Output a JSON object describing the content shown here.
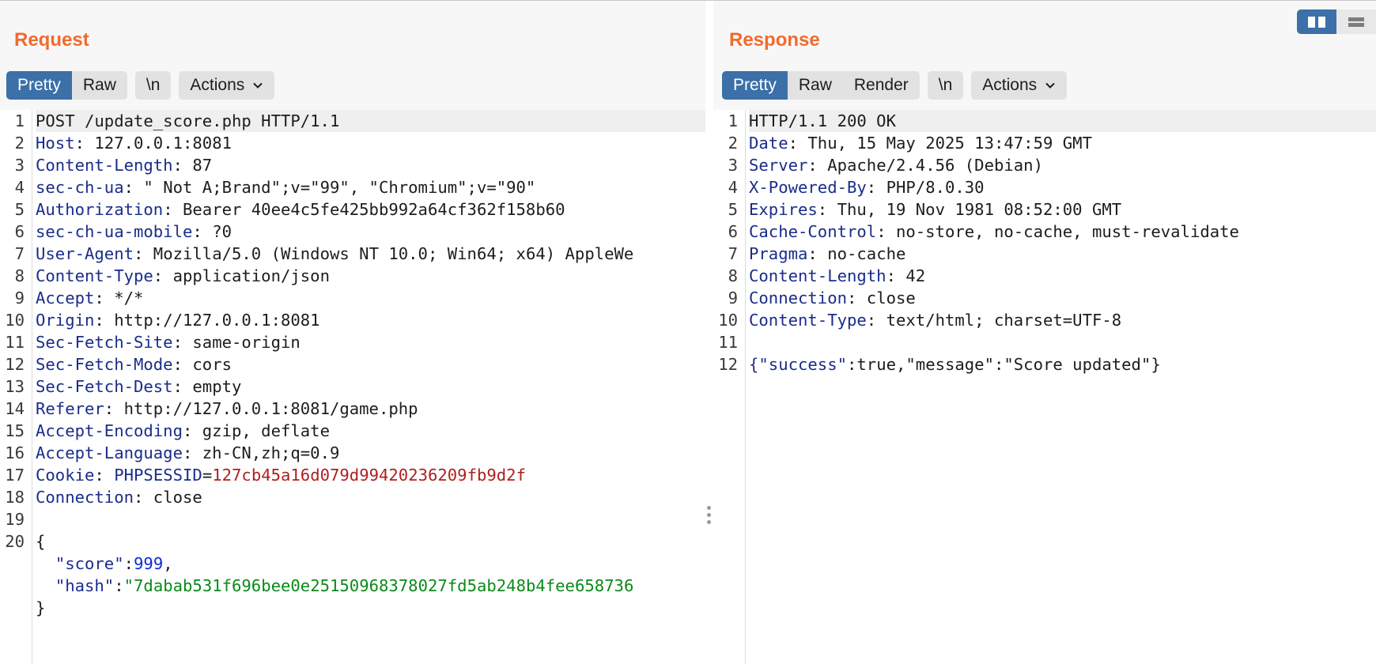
{
  "request": {
    "title": "Request",
    "tabs": [
      {
        "label": "Pretty",
        "active": true
      },
      {
        "label": "Raw",
        "active": false
      }
    ],
    "newline_label": "\\n",
    "actions_label": "Actions",
    "lines": [
      "POST /update_score.php HTTP/1.1",
      "Host: 127.0.0.1:8081",
      "Content-Length: 87",
      "sec-ch-ua: \" Not A;Brand\";v=\"99\", \"Chromium\";v=\"90\"",
      "Authorization: Bearer 40ee4c5fe425bb992a64cf362f158b60",
      "sec-ch-ua-mobile: ?0",
      "User-Agent: Mozilla/5.0 (Windows NT 10.0; Win64; x64) AppleWe",
      "Content-Type: application/json",
      "Accept: */*",
      "Origin: http://127.0.0.1:8081",
      "Sec-Fetch-Site: same-origin",
      "Sec-Fetch-Mode: cors",
      "Sec-Fetch-Dest: empty",
      "Referer: http://127.0.0.1:8081/game.php",
      "Accept-Encoding: gzip, deflate",
      "Accept-Language: zh-CN,zh;q=0.9",
      "Cookie: PHPSESSID=127cb45a16d079d99420236209fb9d2f",
      "Connection: close",
      "",
      "{"
    ],
    "body_lines": [
      {
        "key": "\"score\"",
        "value": "999",
        "type": "num",
        "suffix": ","
      },
      {
        "key": "\"hash\"",
        "value": "\"7dabab531f696bee0e25150968378027fd5ab248b4fee658736",
        "type": "str",
        "suffix": ""
      }
    ],
    "closing": "}"
  },
  "response": {
    "title": "Response",
    "tabs": [
      {
        "label": "Pretty",
        "active": true
      },
      {
        "label": "Raw",
        "active": false
      },
      {
        "label": "Render",
        "active": false
      }
    ],
    "newline_label": "\\n",
    "actions_label": "Actions",
    "lines": [
      "HTTP/1.1 200 OK",
      "Date: Thu, 15 May 2025 13:47:59 GMT",
      "Server: Apache/2.4.56 (Debian)",
      "X-Powered-By: PHP/8.0.30",
      "Expires: Thu, 19 Nov 1981 08:52:00 GMT",
      "Cache-Control: no-store, no-cache, must-revalidate",
      "Pragma: no-cache",
      "Content-Length: 42",
      "Connection: close",
      "Content-Type: text/html; charset=UTF-8",
      "",
      "{\"success\":true,\"message\":\"Score updated\"}"
    ]
  },
  "icons": {
    "chevron": "chevron-down-icon",
    "split_horizontal": "split-horizontal-icon",
    "split_vertical": "split-vertical-icon",
    "drag_handle": "vertical-dots-icon"
  },
  "colors": {
    "title": "#f26a2e",
    "active_tab": "#3b70a8",
    "header_key": "#1a2d8a",
    "string": "#0b8a1a",
    "number": "#0b2bd8",
    "cookie_value": "#b01f1f"
  }
}
